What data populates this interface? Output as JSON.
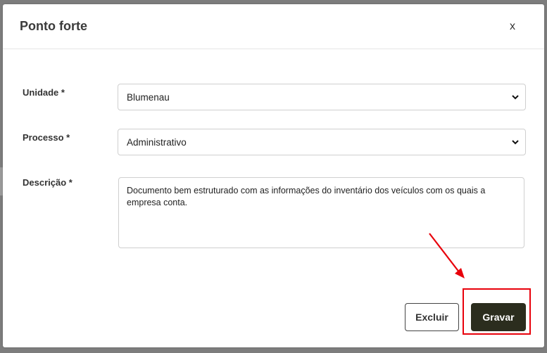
{
  "modal": {
    "title": "Ponto forte",
    "close_glyph": "x"
  },
  "form": {
    "unidade": {
      "label": "Unidade *",
      "value": "Blumenau"
    },
    "processo": {
      "label": "Processo *",
      "value": "Administrativo"
    },
    "descricao": {
      "label": "Descrição *",
      "value": "Documento bem estruturado com as informações do inventário dos veículos com os quais a empresa conta."
    }
  },
  "footer": {
    "delete_label": "Excluir",
    "save_label": "Gravar"
  },
  "annotation": {
    "color": "#e8000b",
    "icons": [
      "arrow-annotation-icon",
      "highlight-box"
    ]
  },
  "colors": {
    "primary_button": "#2b2d1e",
    "backdrop": "#8a8a8a"
  }
}
